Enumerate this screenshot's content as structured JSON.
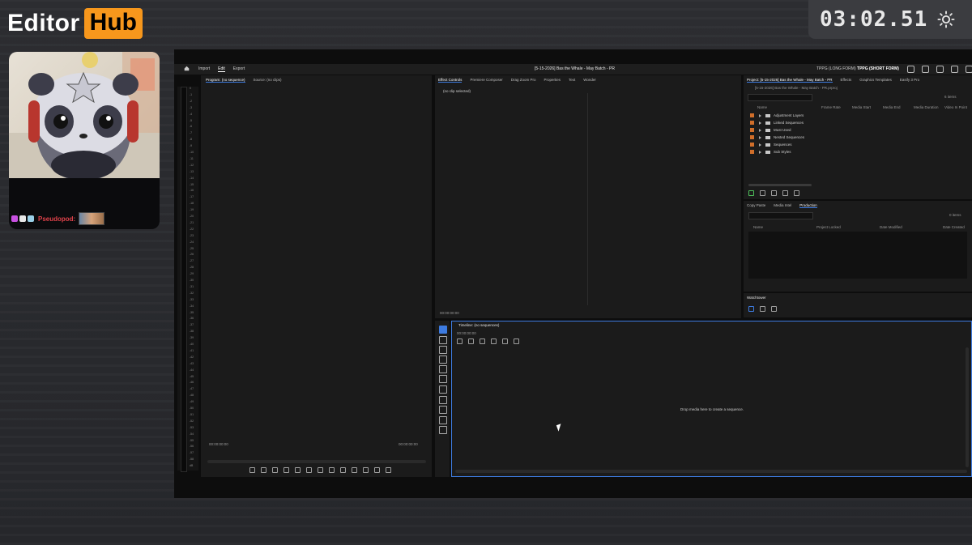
{
  "overlay": {
    "logo_left": "Editor",
    "logo_right": "Hub",
    "timer": "03:02.51",
    "chat_name": "Pseudopod:",
    "colors": {
      "accent_orange": "#f7971c",
      "chat_name_red": "#e0424a"
    }
  },
  "premiere": {
    "nav": {
      "home": "home-icon",
      "import": "Import",
      "edit": "Edit",
      "export": "Export"
    },
    "project_title": "[5-15-2026] Bas the Whale - May Batch - PR",
    "workspace_left": "TPPG (LONG FORM)",
    "workspace_right": "TPPG (SHORT FORM)",
    "program": {
      "tab_program": "Program: (no sequence)",
      "tab_source": "Source: (no clips)",
      "timecode_left": "00:00:00:00",
      "timecode_right": "00:00:00:00"
    },
    "meter_ticks": [
      "0",
      "-1",
      "-2",
      "-3",
      "-4",
      "-5",
      "-6",
      "-7",
      "-8",
      "-9",
      "-10",
      "-11",
      "-12",
      "-13",
      "-14",
      "-15",
      "-16",
      "-17",
      "-18",
      "-19",
      "-20",
      "-21",
      "-22",
      "-23",
      "-24",
      "-25",
      "-26",
      "-27",
      "-28",
      "-29",
      "-30",
      "-31",
      "-32",
      "-33",
      "-34",
      "-35",
      "-36",
      "-37",
      "-38",
      "-39",
      "-40",
      "-41",
      "-42",
      "-43",
      "-44",
      "-45",
      "-46",
      "-47",
      "-48",
      "-49",
      "-50",
      "-51",
      "-52",
      "-53",
      "-54",
      "-55",
      "-56",
      "-57",
      "-58",
      "dB"
    ],
    "effects": {
      "tabs": [
        "Effect Controls",
        "Premiere Composer",
        "Drag Zoom Pro",
        "Properties",
        "Text",
        "Wonder"
      ],
      "no_clip": "(no clip selected)",
      "timecode": "00:00:00:00"
    },
    "project": {
      "tabs": [
        "Project: [5-15-2026] Bas the Whale - May Batch - PR",
        "Effects",
        "Graphics Templates",
        "Easify 3 Pro"
      ],
      "file": "[5-15-2026] Bas the Whale - May Batch - PR.prproj",
      "count": "6 items",
      "columns": [
        "Name",
        "Frame Rate",
        "Media Start",
        "Media End",
        "Media Duration",
        "Video In Point"
      ],
      "items": [
        "Adjustment Layers",
        "Linked Sequences",
        "Must Used",
        "Nested Sequences",
        "Sequences",
        "Sub Styles"
      ]
    },
    "production": {
      "tabs": [
        "Copy Paste",
        "Media Intel",
        "Production"
      ],
      "count": "0 items",
      "columns": [
        "Name",
        "Project Locked",
        "Date Modified",
        "Date Created"
      ]
    },
    "watchtower": {
      "label": "Watchtower"
    },
    "timeline": {
      "title": "Timeline: (no sequences)",
      "timecode": "00:00:00:00",
      "drop_msg": "Drop media here to create a sequence."
    }
  }
}
